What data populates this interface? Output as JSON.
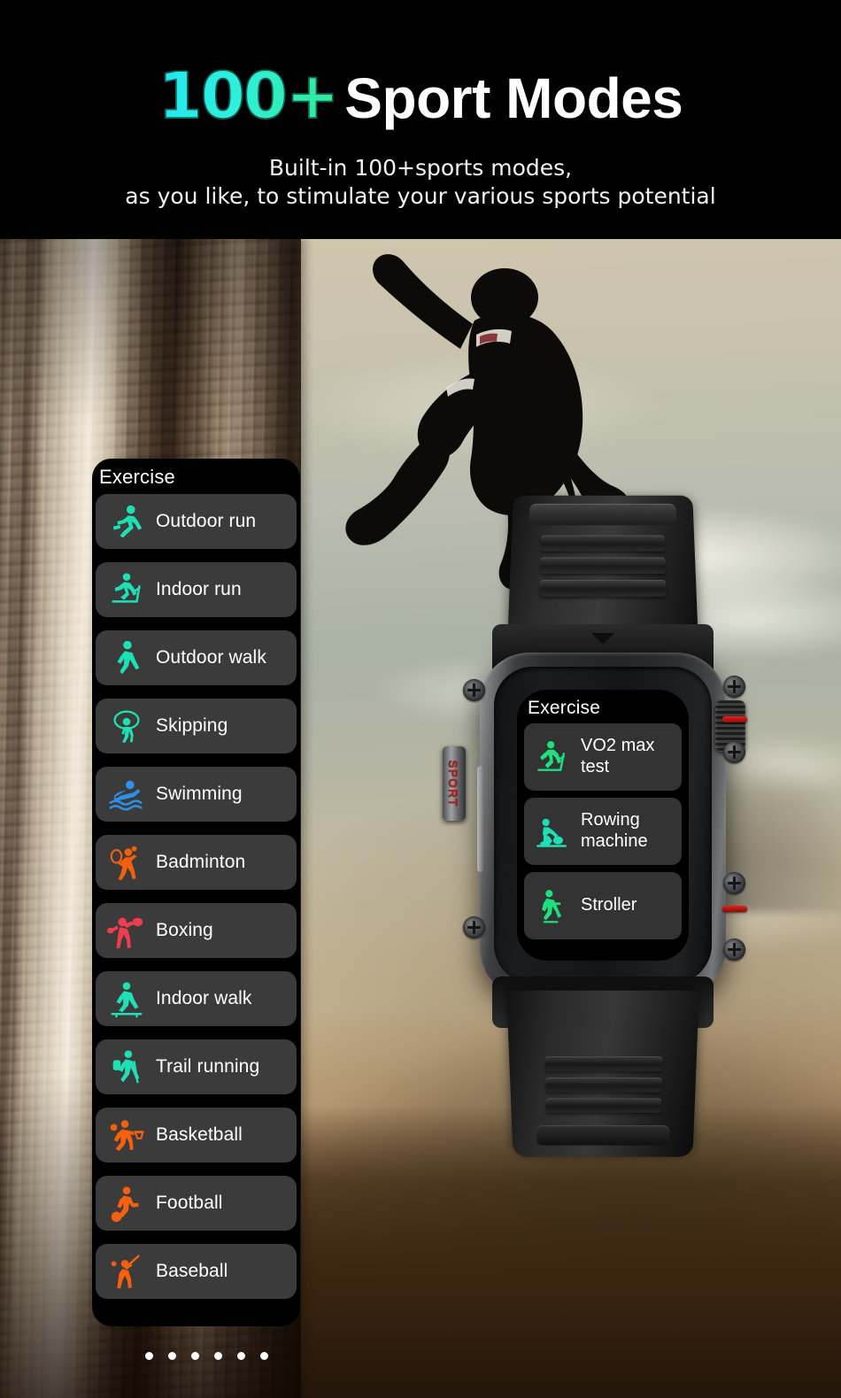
{
  "header": {
    "headline_highlight": "100+",
    "headline_rest": "Sport Modes",
    "subtitle_line1": "Built-in 100+sports modes,",
    "subtitle_line2": "as you like, to stimulate your various sports potential"
  },
  "phone_list": {
    "title": "Exercise",
    "items": [
      {
        "label": "Outdoor run",
        "icon": "running-icon",
        "color": "#1ee0b4"
      },
      {
        "label": "Indoor run",
        "icon": "treadmill-icon",
        "color": "#1ee0b4"
      },
      {
        "label": "Outdoor walk",
        "icon": "walking-icon",
        "color": "#1ee0b4"
      },
      {
        "label": "Skipping",
        "icon": "jump-rope-icon",
        "color": "#1ee0b4"
      },
      {
        "label": "Swimming",
        "icon": "swimming-icon",
        "color": "#2f90e8"
      },
      {
        "label": "Badminton",
        "icon": "badminton-icon",
        "color": "#f4600d"
      },
      {
        "label": "Boxing",
        "icon": "boxing-icon",
        "color": "#ef3d4e"
      },
      {
        "label": "Indoor walk",
        "icon": "indoor-walk-icon",
        "color": "#1ee0b4"
      },
      {
        "label": "Trail running",
        "icon": "hiking-icon",
        "color": "#1ee0b4"
      },
      {
        "label": "Basketball",
        "icon": "basketball-icon",
        "color": "#f4600d"
      },
      {
        "label": "Football",
        "icon": "football-icon",
        "color": "#f4600d"
      },
      {
        "label": "Baseball",
        "icon": "baseball-icon",
        "color": "#f4600d"
      }
    ],
    "pagination_dots": 6
  },
  "watch": {
    "screen_title": "Exercise",
    "side_button_label": "SPORT",
    "items": [
      {
        "label": "VO2 max test",
        "icon": "vo2-treadmill-icon",
        "color": "#1fe07f"
      },
      {
        "label": "Rowing machine",
        "icon": "rowing-icon",
        "color": "#1ee0b4"
      },
      {
        "label": "Stroller",
        "icon": "stroller-walk-icon",
        "color": "#1fe07f"
      }
    ]
  },
  "scene": {
    "background_description": "rock climber silhouette on limestone cliff at dusk"
  },
  "colors": {
    "accent_cyan": "#23e6f0",
    "accent_green": "#32e887",
    "panel_bg": "#000000",
    "row_bg": "#3b3b3b",
    "text_primary": "#ffffff",
    "sport_red": "#b3201a"
  }
}
